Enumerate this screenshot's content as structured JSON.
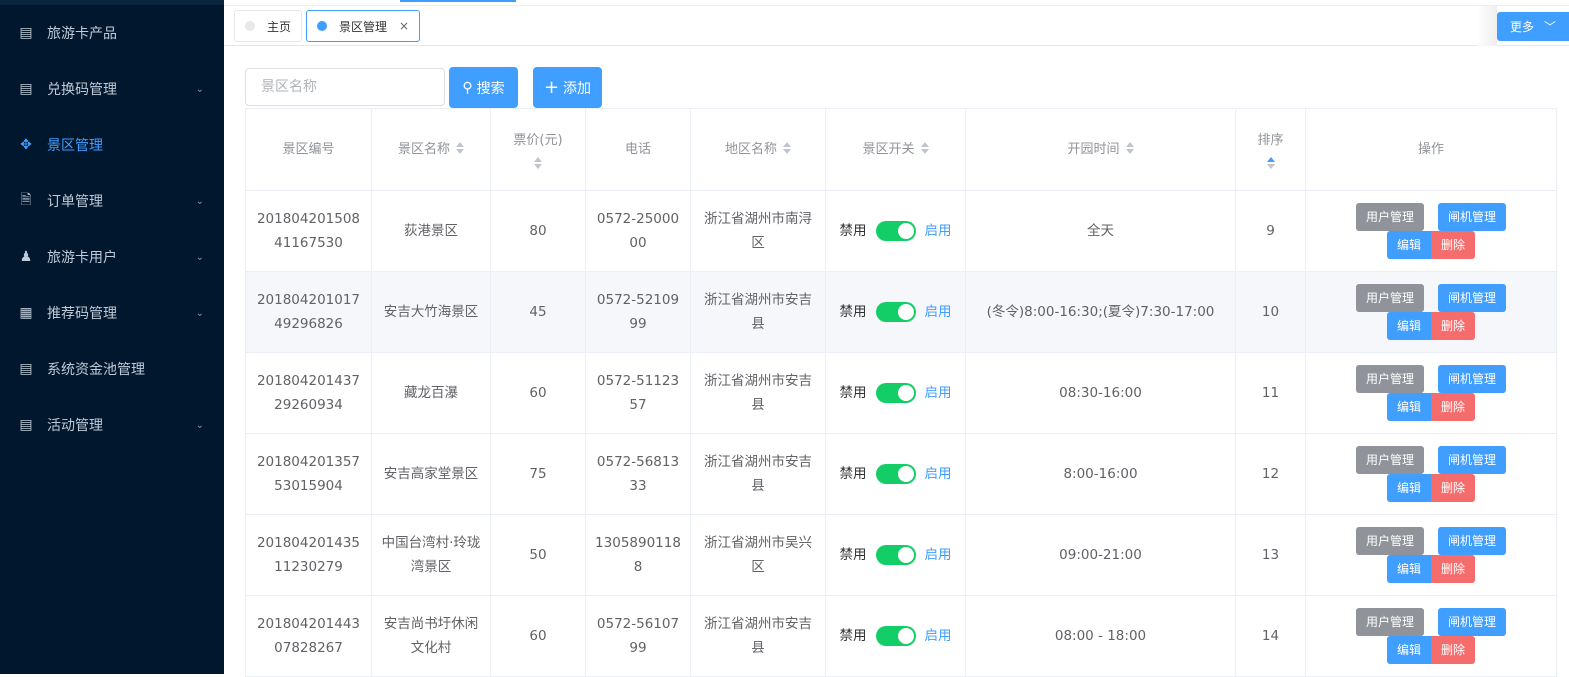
{
  "sidebar": {
    "items": [
      {
        "label": "旅游卡产品",
        "icon": "document-icon",
        "chev": false
      },
      {
        "label": "兑换码管理",
        "icon": "document-icon",
        "chev": true
      },
      {
        "label": "景区管理",
        "icon": "move-icon",
        "chev": false,
        "active": true
      },
      {
        "label": "订单管理",
        "icon": "file-icon",
        "chev": true
      },
      {
        "label": "旅游卡用户",
        "icon": "user-icon",
        "chev": true
      },
      {
        "label": "推荐码管理",
        "icon": "grid-icon",
        "chev": true
      },
      {
        "label": "系统资金池管理",
        "icon": "document-icon",
        "chev": false
      },
      {
        "label": "活动管理",
        "icon": "document-icon",
        "chev": true
      }
    ]
  },
  "tabs": {
    "home": "主页",
    "current": "景区管理",
    "close": "×",
    "more": "更多"
  },
  "toolbar": {
    "search_placeholder": "景区名称",
    "search_label": "搜索",
    "add_label": "添加"
  },
  "table": {
    "headers": [
      "景区编号",
      "景区名称",
      "票价(元)",
      "电话",
      "地区名称",
      "景区开关",
      "开园时间",
      "排序",
      "操作"
    ],
    "switch_off": "禁用",
    "switch_on": "启用",
    "actions": {
      "user": "用户管理",
      "gate": "闸机管理",
      "edit": "编辑",
      "delete": "删除"
    },
    "rows": [
      {
        "id": "20180420150841167530",
        "name": "荻港景区",
        "price": "80",
        "phone": "0572-2500000",
        "region": "浙江省湖州市南浔区",
        "hours": "全天",
        "order": "9",
        "enabled": true
      },
      {
        "id": "20180420101749296826",
        "name": "安吉大竹海景区",
        "price": "45",
        "phone": "0572-5210999",
        "region": "浙江省湖州市安吉县",
        "hours": "(冬令)8:00-16:30;(夏令)7:30-17:00",
        "order": "10",
        "enabled": true
      },
      {
        "id": "20180420143729260934",
        "name": "藏龙百瀑",
        "price": "60",
        "phone": "0572-5112357",
        "region": "浙江省湖州市安吉县",
        "hours": "08:30-16:00",
        "order": "11",
        "enabled": true
      },
      {
        "id": "20180420135753015904",
        "name": "安吉高家堂景区",
        "price": "75",
        "phone": "0572-5681333",
        "region": "浙江省湖州市安吉县",
        "hours": "8:00-16:00",
        "order": "12",
        "enabled": true
      },
      {
        "id": "20180420143511230279",
        "name": "中国台湾村·玲珑湾景区",
        "price": "50",
        "phone": "13058901188",
        "region": "浙江省湖州市吴兴区",
        "hours": "09:00-21:00",
        "order": "13",
        "enabled": true
      },
      {
        "id": "20180420144307828267",
        "name": "安吉尚书圩休闲文化村",
        "price": "60",
        "phone": "0572-5610799",
        "region": "浙江省湖州市安吉县",
        "hours": "08:00 - 18:00",
        "order": "14",
        "enabled": true
      }
    ]
  }
}
